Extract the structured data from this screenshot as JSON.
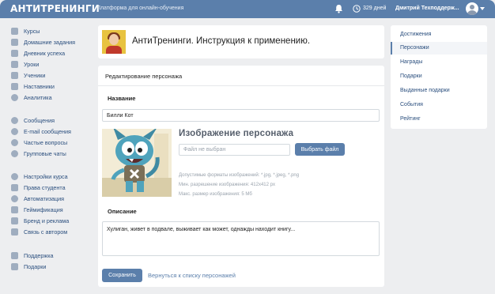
{
  "header": {
    "logo": "АНТИТРЕНИНГИ",
    "tagline": "Платформа для онлайн-обучения",
    "days": "329 дней",
    "user_name": "Дмитрий Техподдерж..."
  },
  "sidebar": {
    "groups": [
      [
        {
          "label": "Курсы",
          "icon": "book-icon"
        },
        {
          "label": "Домашние задания",
          "icon": "pencil-icon"
        },
        {
          "label": "Дневник успеха",
          "icon": "notebook-icon"
        },
        {
          "label": "Уроки",
          "icon": "video-icon"
        },
        {
          "label": "Ученики",
          "icon": "students-icon"
        },
        {
          "label": "Наставники",
          "icon": "mentors-icon"
        },
        {
          "label": "Аналитика",
          "icon": "pie-chart-icon"
        }
      ],
      [
        {
          "label": "Сообщения",
          "icon": "chat-icon"
        },
        {
          "label": "E-mail сообщения",
          "icon": "at-icon"
        },
        {
          "label": "Частые вопросы",
          "icon": "question-icon"
        },
        {
          "label": "Групповые чаты",
          "icon": "group-chat-icon"
        }
      ],
      [
        {
          "label": "Настройки курса",
          "icon": "gear-icon"
        },
        {
          "label": "Права студента",
          "icon": "checkbox-icon"
        },
        {
          "label": "Автоматизация",
          "icon": "automation-icon"
        },
        {
          "label": "Геймификация",
          "icon": "gamepad-icon"
        },
        {
          "label": "Бренд и реклама",
          "icon": "brand-icon"
        },
        {
          "label": "Связь с автором",
          "icon": "link-icon"
        }
      ],
      [
        {
          "label": "Поддержка",
          "icon": "phone-icon"
        },
        {
          "label": "Подарки",
          "icon": "gift-icon"
        }
      ]
    ]
  },
  "title_card": {
    "title": "АнтиТренинги. Инструкция к применению."
  },
  "edit": {
    "header": "Редактирование персонажа",
    "name_label": "Название",
    "name_value": "Билли Кот",
    "image_title": "Изображение персонажа",
    "file_placeholder": "Файл не выбран",
    "choose_file": "Выбрать файл",
    "hints": [
      "Допустимые форматы изображений: *.jpg, *.jpeg, *.png",
      "Мин. разрешение изображения: 412x412 px",
      "Макс. размер изображения: 5 Мб"
    ],
    "description_label": "Описание",
    "description_value": "Хулиган, живет в подвале, выживает как может, однажды находит книгу...",
    "save": "Сохранить",
    "back": "Вернуться к списку персонажей"
  },
  "right_menu": {
    "items": [
      "Достижения",
      "Персонажи",
      "Награды",
      "Подарки",
      "Выданные подарки",
      "События",
      "Рейтинг"
    ],
    "active_index": 1
  },
  "colors": {
    "accent": "#5b7fab",
    "background": "#edeef0",
    "link": "#2b4f7e"
  }
}
